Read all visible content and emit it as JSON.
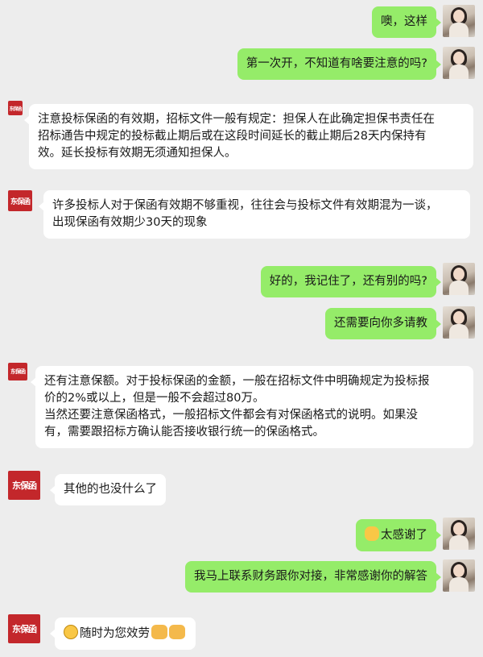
{
  "brand": {
    "logo_text": "东保函"
  },
  "messages": [
    {
      "id": "m1",
      "side": "out",
      "lines": [
        "噢，这样"
      ]
    },
    {
      "id": "m2",
      "side": "out",
      "lines": [
        "第一次开，不知道有啥要注意的吗?"
      ]
    },
    {
      "id": "m3",
      "side": "in",
      "lines": [
        "注意投标保函的有效期，招标文件一般有规定：担保人在此确定担保书责任在",
        "招标通告中规定的投标截止期后或在这段时间延长的截止期后28天内保持有",
        "效。延长投标有效期无须通知担保人。"
      ]
    },
    {
      "id": "m4",
      "side": "in",
      "lines": [
        "许多投标人对于保函有效期不够重视，往往会与投标文件有效期混为一谈，",
        "出现保函有效期少30天的现象"
      ]
    },
    {
      "id": "m5",
      "side": "out",
      "lines": [
        "好的，我记住了，还有别的吗?"
      ]
    },
    {
      "id": "m6",
      "side": "out",
      "lines": [
        "还需要向你多请教"
      ]
    },
    {
      "id": "m7",
      "side": "in",
      "lines": [
        "还有注意保额。对于投标保函的金额，一般在招标文件中明确规定为投标报",
        "价的2%或以上，但是一般不会超过80万。",
        "当然还要注意保函格式，一般招标文件都会有对保函格式的说明。如果没",
        "有，需要跟招标方确认能否接收银行统一的保函格式。"
      ]
    },
    {
      "id": "m8",
      "side": "in",
      "lines": [
        "其他的也没什么了"
      ]
    },
    {
      "id": "m9",
      "side": "out",
      "lines": [
        "太感谢了"
      ],
      "emoji": "ok-hand-emoji"
    },
    {
      "id": "m10",
      "side": "out",
      "lines": [
        "我马上联系财务跟你对接，非常感谢你的解答"
      ]
    },
    {
      "id": "m11",
      "side": "in",
      "lines": [
        "随时为您效劳"
      ],
      "emoji": "grin-emoji",
      "emoji_after": "handshake-emoji"
    }
  ],
  "colors": {
    "background": "#ededed",
    "out_bubble": "#95ec69",
    "in_bubble": "#ffffff",
    "brand_red": "#c3272b"
  }
}
